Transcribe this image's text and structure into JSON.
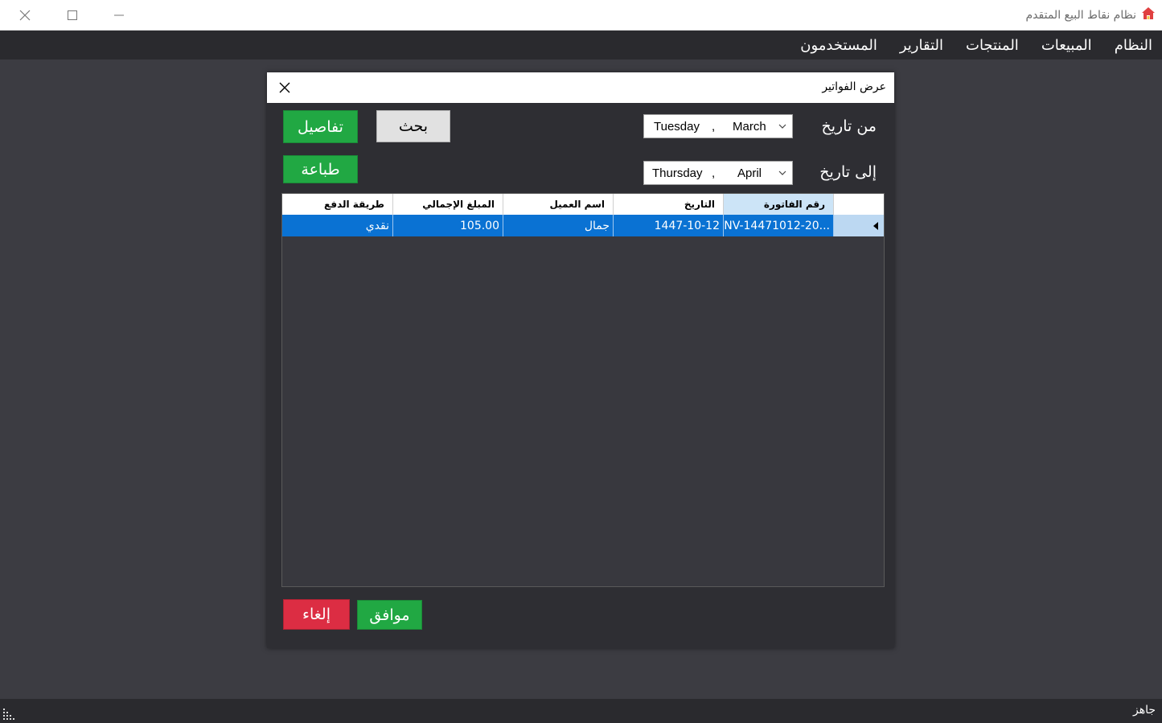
{
  "window": {
    "title": "نظام نقاط البيع المتقدم",
    "icon": "home-icon"
  },
  "menu": [
    {
      "label": "النظام"
    },
    {
      "label": "المبيعات"
    },
    {
      "label": "المنتجات"
    },
    {
      "label": "التقارير"
    },
    {
      "label": "المستخدمون"
    }
  ],
  "dialog": {
    "title": "عرض الفواتير",
    "from_label": "من تاريخ",
    "to_label": "إلى تاريخ",
    "from_date": {
      "day": "Tuesday",
      "comma": ",",
      "month": "March"
    },
    "to_date": {
      "day": "Thursday",
      "comma": ",",
      "month": "April"
    },
    "buttons": {
      "details": "تفاصيل",
      "search": "بحث",
      "print": "طباعة",
      "ok": "موافق",
      "cancel": "إلغاء"
    },
    "grid": {
      "columns": [
        "رقم الفاتورة",
        "التاريخ",
        "اسم العميل",
        "المبلغ الإجمالي",
        "طريقة الدفع"
      ],
      "rows": [
        {
          "invoice": "INV-14471012-20...",
          "date": "1447-10-12",
          "customer": "جمال",
          "total": "105.00",
          "payment": "نقدي"
        }
      ]
    }
  },
  "status": {
    "text": "جاهز"
  },
  "colors": {
    "green": "#21a843",
    "red": "#dc2d43",
    "selection": "#0a72d3",
    "background": "#3c3c42"
  }
}
